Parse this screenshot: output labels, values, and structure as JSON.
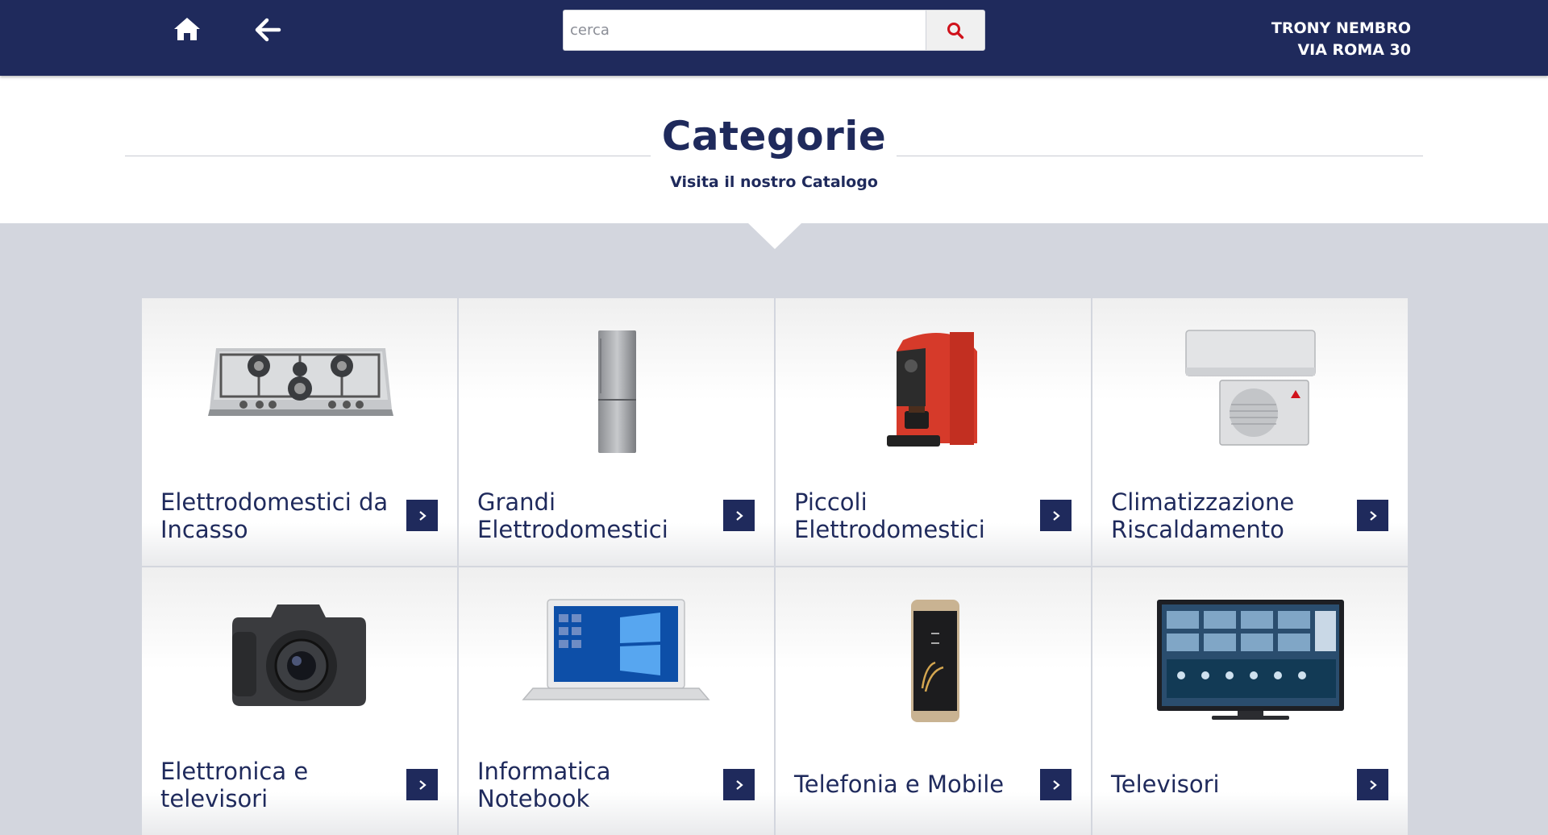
{
  "topbar": {
    "search_placeholder": "cerca",
    "store_name": "TRONY NEMBRO",
    "store_address": "VIA ROMA 30",
    "icons": [
      "home-icon",
      "back-arrow-icon",
      "search-icon"
    ]
  },
  "header": {
    "title": "Categorie",
    "subtitle": "Visita il nostro Catalogo"
  },
  "categories": [
    {
      "label": "Elettrodomestici da Incasso",
      "image": "gas-hob-image"
    },
    {
      "label": "Grandi Elettrodomestici",
      "image": "refrigerator-image"
    },
    {
      "label": "Piccoli Elettrodomestici",
      "image": "coffee-machine-image"
    },
    {
      "label": "Climatizzazione Riscaldamento",
      "image": "air-conditioner-image"
    },
    {
      "label": "Elettronica e televisori",
      "image": "camera-image"
    },
    {
      "label": "Informatica Notebook",
      "image": "laptop-image"
    },
    {
      "label": "Telefonia e Mobile",
      "image": "smartphone-image"
    },
    {
      "label": "Televisori",
      "image": "television-image"
    }
  ],
  "colors": {
    "navy": "#1f2a5c",
    "search_icon": "#d0121b",
    "page_background": "#d3d6de"
  }
}
